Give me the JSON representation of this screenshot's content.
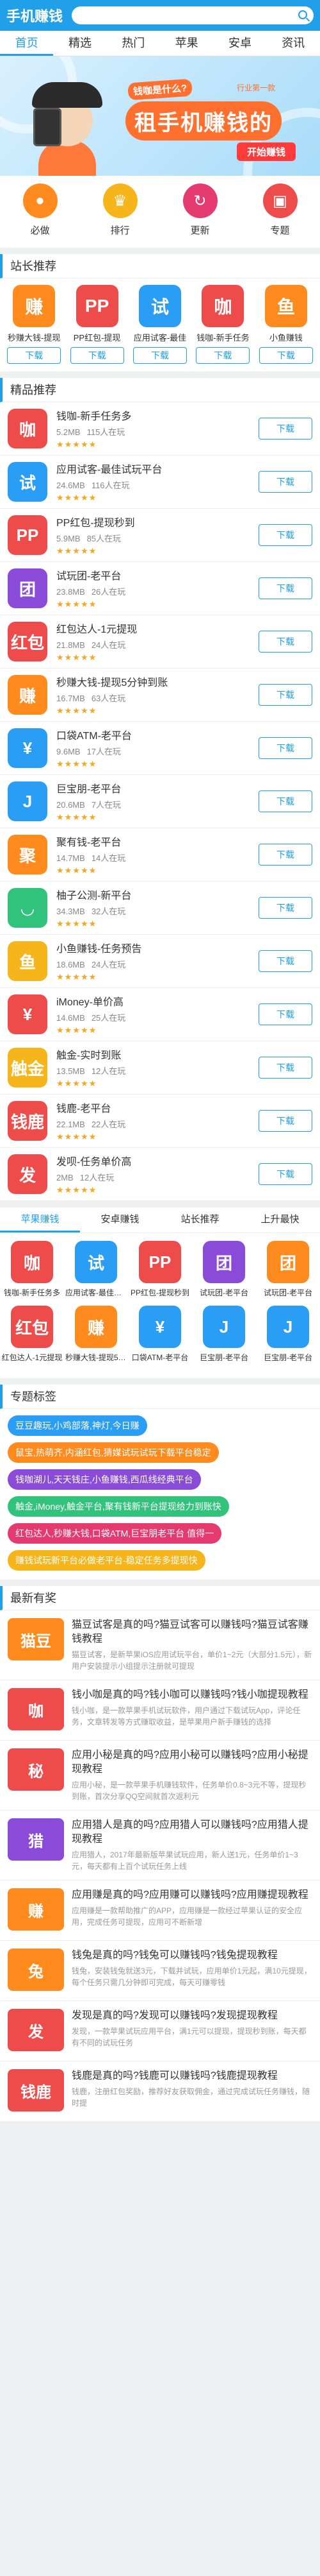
{
  "header": {
    "logo": "手机赚钱",
    "search_placeholder": ""
  },
  "nav": [
    "首页",
    "精选",
    "热门",
    "苹果",
    "安卓",
    "资讯"
  ],
  "banner": {
    "question": "钱咖是什么?",
    "small": "行业第一款",
    "slogan": "租手机赚钱的",
    "cta": "开始赚钱"
  },
  "quick": [
    {
      "label": "必做",
      "icon": "coin-icon",
      "color": "#ff8a1e"
    },
    {
      "label": "排行",
      "icon": "trophy-icon",
      "color": "#f5b51b"
    },
    {
      "label": "更新",
      "icon": "refresh-icon",
      "color": "#e53a70"
    },
    {
      "label": "专题",
      "icon": "topic-icon",
      "color": "#ee4b4b"
    }
  ],
  "station": {
    "title": "站长推荐",
    "button": "下载",
    "items": [
      {
        "name": "秒赚大钱-提现",
        "glyph": "赚",
        "color": "#ff8a1e"
      },
      {
        "name": "PP红包-提现",
        "glyph": "PP",
        "color": "#ee4b4b"
      },
      {
        "name": "应用试客-最佳",
        "glyph": "试",
        "color": "#2a9df4"
      },
      {
        "name": "钱咖-新手任务",
        "glyph": "咖",
        "color": "#ee4b4b"
      },
      {
        "name": "小鱼赚钱",
        "glyph": "鱼",
        "color": "#ff8a1e"
      }
    ]
  },
  "featured": {
    "title": "精品推荐",
    "button": "下载",
    "items": [
      {
        "name": "钱咖-新手任务多",
        "size": "5.2MB",
        "users": "115人在玩",
        "stars": "★★★★★",
        "glyph": "咖",
        "color": "#ee4b4b"
      },
      {
        "name": "应用试客-最佳试玩平台",
        "size": "24.6MB",
        "users": "116人在玩",
        "stars": "★★★★★",
        "glyph": "试",
        "color": "#2a9df4"
      },
      {
        "name": "PP红包-提现秒到",
        "size": "5.9MB",
        "users": "85人在玩",
        "stars": "★★★★★",
        "glyph": "PP",
        "color": "#ee4b4b"
      },
      {
        "name": "试玩团-老平台",
        "size": "23.8MB",
        "users": "26人在玩",
        "stars": "★★★★★",
        "glyph": "团",
        "color": "#8a4bd8"
      },
      {
        "name": "红包达人-1元提现",
        "size": "21.8MB",
        "users": "24人在玩",
        "stars": "★★★★★",
        "glyph": "红包",
        "color": "#ee4b4b"
      },
      {
        "name": "秒赚大钱-提现5分钟到账",
        "size": "16.7MB",
        "users": "63人在玩",
        "stars": "★★★★★",
        "glyph": "赚",
        "color": "#ff8a1e"
      },
      {
        "name": "口袋ATM-老平台",
        "size": "9.6MB",
        "users": "17人在玩",
        "stars": "★★★★★",
        "glyph": "¥",
        "color": "#2a9df4"
      },
      {
        "name": "巨宝朋-老平台",
        "size": "20.6MB",
        "users": "7人在玩",
        "stars": "★★★★★",
        "glyph": "J",
        "color": "#2a9df4"
      },
      {
        "name": "聚有钱-老平台",
        "size": "14.7MB",
        "users": "14人在玩",
        "stars": "★★★★★",
        "glyph": "聚",
        "color": "#ff8a1e"
      },
      {
        "name": "柚子公测-新平台",
        "size": "34.3MB",
        "users": "32人在玩",
        "stars": "★★★★★",
        "glyph": "◡",
        "color": "#31c27c"
      },
      {
        "name": "小鱼赚钱-任务预告",
        "size": "18.6MB",
        "users": "24人在玩",
        "stars": "★★★★★",
        "glyph": "鱼",
        "color": "#f5b51b"
      },
      {
        "name": "iMoney-单价高",
        "size": "14.6MB",
        "users": "25人在玩",
        "stars": "★★★★★",
        "glyph": "¥",
        "color": "#ee4b4b"
      },
      {
        "name": "触金-实时到账",
        "size": "13.5MB",
        "users": "12人在玩",
        "stars": "★★★★★",
        "glyph": "触金",
        "color": "#f5b51b"
      },
      {
        "name": "钱鹿-老平台",
        "size": "22.1MB",
        "users": "22人在玩",
        "stars": "★★★★★",
        "glyph": "钱鹿",
        "color": "#ee4b4b"
      },
      {
        "name": "发呗-任务单价高",
        "size": "2MB",
        "users": "12人在玩",
        "stars": "★★★★★",
        "glyph": "发",
        "color": "#ee4b4b"
      }
    ]
  },
  "tabs2": [
    "苹果赚钱",
    "安卓赚钱",
    "站长推荐",
    "上升最快"
  ],
  "grid": [
    {
      "name": "钱咖-新手任务多",
      "glyph": "咖",
      "color": "#ee4b4b"
    },
    {
      "name": "应用试客-最佳试玩",
      "glyph": "试",
      "color": "#2a9df4"
    },
    {
      "name": "PP红包-提现秒到",
      "glyph": "PP",
      "color": "#ee4b4b"
    },
    {
      "name": "试玩团-老平台",
      "glyph": "团",
      "color": "#8a4bd8"
    },
    {
      "name": "试玩团-老平台",
      "glyph": "团",
      "color": "#ff8a1e"
    },
    {
      "name": "红包达人-1元提现",
      "glyph": "红包",
      "color": "#ee4b4b"
    },
    {
      "name": "秒赚大钱-提现5分钟",
      "glyph": "赚",
      "color": "#ff8a1e"
    },
    {
      "name": "口袋ATM-老平台",
      "glyph": "¥",
      "color": "#2a9df4"
    },
    {
      "name": "巨宝朋-老平台",
      "glyph": "J",
      "color": "#2a9df4"
    },
    {
      "name": "巨宝朋-老平台",
      "glyph": "J",
      "color": "#2a9df4"
    }
  ],
  "topics": {
    "title": "专题标签",
    "tags": [
      {
        "text": "豆豆趣玩,小鸡部落,神灯,今日赚",
        "color": "#2a9df4"
      },
      {
        "text": "鼠宝,热萌齐,内涵红包,猜媒试玩试玩下载平台稳定",
        "color": "#ff8a1e"
      },
      {
        "text": "钱咖湖儿,天天钱庄,小鱼赚钱,西瓜线经典平台",
        "color": "#8a4bd8"
      },
      {
        "text": "触金,iMoney,触金平台,聚有钱新平台提现给力到账快",
        "color": "#31c27c"
      },
      {
        "text": "红包达人,秒赚大钱,口袋ATM,巨宝朋老平台 值得一",
        "color": "#e53a70"
      },
      {
        "text": "赚钱试玩新平台必做老平台-稳定任务多提现快",
        "color": "#f5b51b"
      }
    ]
  },
  "news": {
    "title": "最新有奖",
    "items": [
      {
        "title": "猫豆试客是真的吗?猫豆试客可以赚钱吗?猫豆试客赚钱教程",
        "desc": "猫豆试客，是新苹果iOS应用试玩平台，单价1~2元（大部分1.5元），新用户安装提示小组提示注册就可提现",
        "glyph": "猫豆",
        "color": "#ff8a1e"
      },
      {
        "title": "钱小咖是真的吗?钱小咖可以赚钱吗?钱小咖提现教程",
        "desc": "钱小咖，是一款苹果手机试玩软件，用户通过下载试玩App，评论任务，文章转发等方式赚取收益，是苹果用户新手赚钱的选择",
        "glyph": "咖",
        "color": "#ee4b4b"
      },
      {
        "title": "应用小秘是真的吗?应用小秘可以赚钱吗?应用小秘提现教程",
        "desc": "应用小秘，是一款苹果手机赚钱软件，任务单价0.8~3元不等，提现秒到账，首次分享QQ空间就首次返利元",
        "glyph": "秘",
        "color": "#ee4b4b"
      },
      {
        "title": "应用猎人是真的吗?应用猎人可以赚钱吗?应用猎人提现教程",
        "desc": "应用猎人，2017年最新版苹果试玩应用，新人送1元，任务单价1~3元，每天都有上百个试玩任务上线",
        "glyph": "猎",
        "color": "#8a4bd8"
      },
      {
        "title": "应用赚是真的吗?应用赚可以赚钱吗?应用赚提现教程",
        "desc": "应用赚是一款帮助推广的APP，应用赚是一款经过苹果认证的安全应用，完成任务可提现，应用可不断新增",
        "glyph": "赚",
        "color": "#ff8a1e"
      },
      {
        "title": "钱兔是真的吗?钱兔可以赚钱吗?钱兔提现教程",
        "desc": "钱兔，安装钱兔就送3元，下载并试玩，应用单价1元起，满10元提现，每个任务只需几分钟即可完成，每天可赚零钱",
        "glyph": "兔",
        "color": "#ff8a1e"
      },
      {
        "title": "发现是真的吗?发现可以赚钱吗?发现提现教程",
        "desc": "发现，一款苹果试玩应用平台，满1元可以提现，提现秒到账，每天都有不同的试玩任务",
        "glyph": "发",
        "color": "#ee4b4b"
      },
      {
        "title": "钱鹿是真的吗?钱鹿可以赚钱吗?钱鹿提现教程",
        "desc": "钱鹿，注册红包奖励，推荐好友获取佣金，通过完成试玩任务赚钱，随时提",
        "glyph": "钱鹿",
        "color": "#ee4b4b"
      }
    ]
  }
}
